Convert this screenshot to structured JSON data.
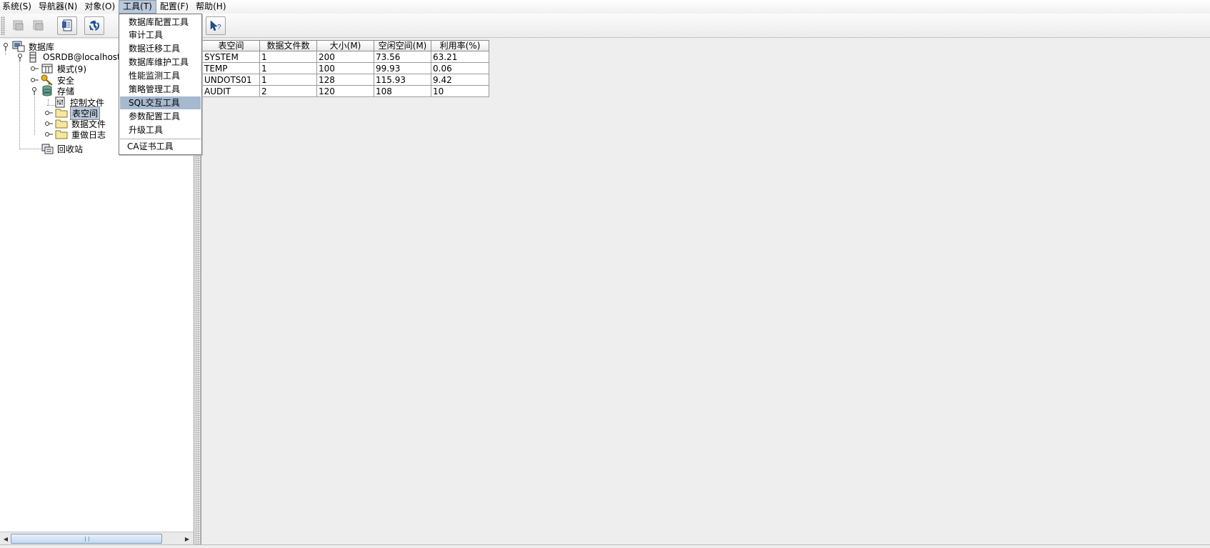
{
  "menubar": {
    "items": [
      "系统(S)",
      "导航器(N)",
      "对象(O)",
      "工具(T)",
      "配置(F)",
      "帮助(H)"
    ]
  },
  "toolbar": {
    "buttons": [
      "db-connect-icon",
      "db-disconnect-icon",
      "properties-icon",
      "refresh-icon",
      "help-icon"
    ]
  },
  "tree": {
    "root": "数据库",
    "connection": "OSRDB@localhost:2",
    "schema": "模式(9)",
    "security": "安全",
    "storage": "存储",
    "control_file": "控制文件",
    "tablespace": "表空间",
    "datafile": "数据文件",
    "redo_log": "重做日志",
    "recycle_bin": "回收站"
  },
  "tools_menu": {
    "items": [
      "数据库配置工具",
      "审计工具",
      "数据迁移工具",
      "数据库维护工具",
      "性能监测工具",
      "策略管理工具",
      "SQL交互工具",
      "参数配置工具",
      "升级工具",
      "CA证书工具"
    ],
    "highlighted": "SQL交互工具"
  },
  "table": {
    "headers": [
      "表空间",
      "数据文件数",
      "大小(M)",
      "空闲空间(M)",
      "利用率(%)"
    ],
    "rows": [
      [
        "SYSTEM",
        "1",
        "200",
        "73.56",
        "63.21"
      ],
      [
        "TEMP",
        "1",
        "100",
        "99.93",
        "0.06"
      ],
      [
        "UNDOTS01",
        "1",
        "128",
        "115.93",
        "9.42"
      ],
      [
        "AUDIT",
        "2",
        "120",
        "108",
        "10"
      ]
    ]
  },
  "colors": {
    "selection": "#b9c8da",
    "menu_highlight": "#a6b9cf",
    "scroll_thumb": "#c5d9ee"
  }
}
